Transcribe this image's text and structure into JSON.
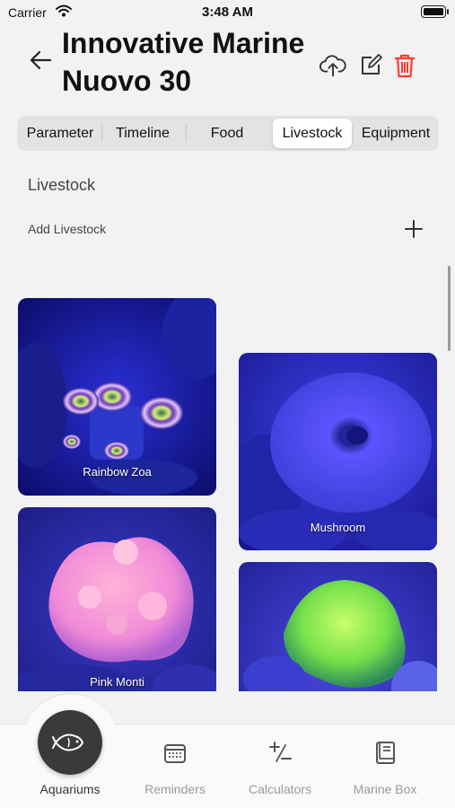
{
  "status_bar": {
    "carrier": "Carrier",
    "time": "3:48 AM"
  },
  "header": {
    "title": "Innovative Marine Nuovo 30",
    "icons": [
      "back-arrow-icon",
      "cloud-upload-icon",
      "edit-icon",
      "trash-icon"
    ],
    "trash_color": "#ff3b30"
  },
  "segments": {
    "items": [
      "Parameter",
      "Timeline",
      "Food",
      "Livestock",
      "Equipment"
    ],
    "selected": "Livestock"
  },
  "livestock": {
    "section_title": "Livestock",
    "add_label": "Add Livestock",
    "cards": [
      {
        "name": "Rainbow Zoa",
        "image": "zoanthid-coral-photo"
      },
      {
        "name": "Mushroom",
        "image": "mushroom-coral-photo"
      },
      {
        "name": "Pink Monti",
        "image": "montipora-coral-photo"
      },
      {
        "name": "",
        "image": "green-coral-photo"
      }
    ]
  },
  "tabbar": {
    "items": [
      {
        "label": "Aquariums",
        "icon": "fish-icon",
        "active": true
      },
      {
        "label": "Reminders",
        "icon": "calendar-icon",
        "active": false
      },
      {
        "label": "Calculators",
        "icon": "plus-minus-icon",
        "active": false
      },
      {
        "label": "Marine Box",
        "icon": "book-icon",
        "active": false
      }
    ]
  }
}
